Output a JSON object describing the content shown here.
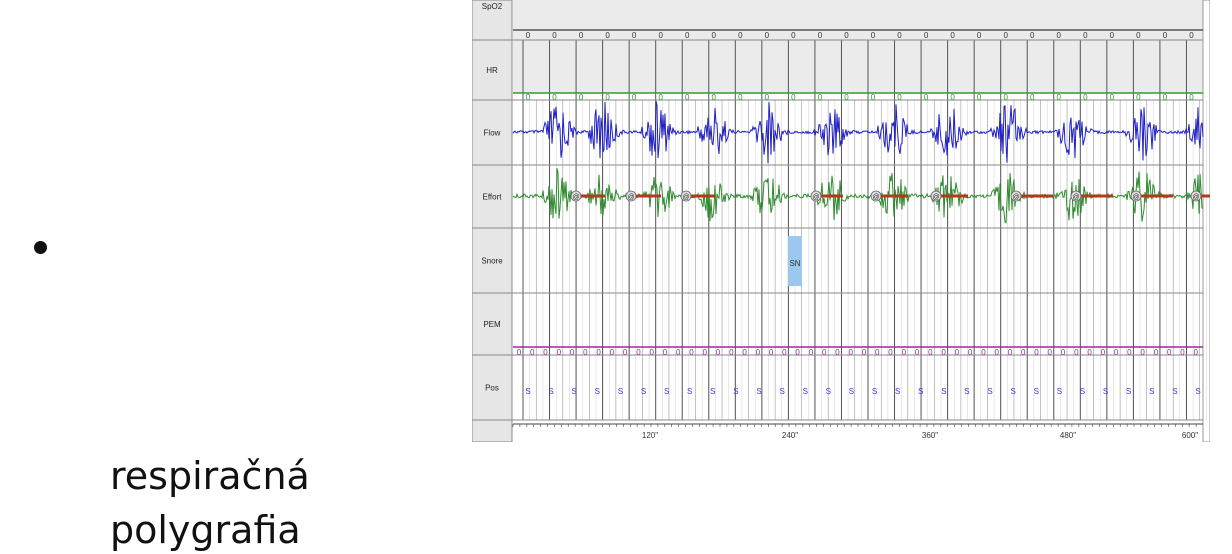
{
  "slide": {
    "bullet_line1": "respiračná",
    "bullet_line2": "polygrafia"
  },
  "recording": {
    "channels": [
      "SpO2",
      "HR",
      "Flow",
      "Effort",
      "Snore",
      "PEM",
      "Pos"
    ],
    "spo2_marker": "0",
    "hr_marker": "0",
    "pem_marker": "0",
    "pos_marker": "S",
    "effort_event_marker": "@",
    "snore_event_label": "SN",
    "time_ticks": [
      "120\"",
      "240\"",
      "360\"",
      "480\"",
      "600\""
    ],
    "colors": {
      "label_bg": "#e6e6e6",
      "track_bg": "#ebebeb",
      "flow": "#1f1fc8",
      "effort": "#2e8b2e",
      "effort_event": "#b23a1a",
      "hr_line": "#2aa02a",
      "spo2_line": "#555555",
      "pem_line": "#9a2a9a",
      "pos_text": "#3a3ae0",
      "snore_event": "#9cc8f0"
    }
  }
}
